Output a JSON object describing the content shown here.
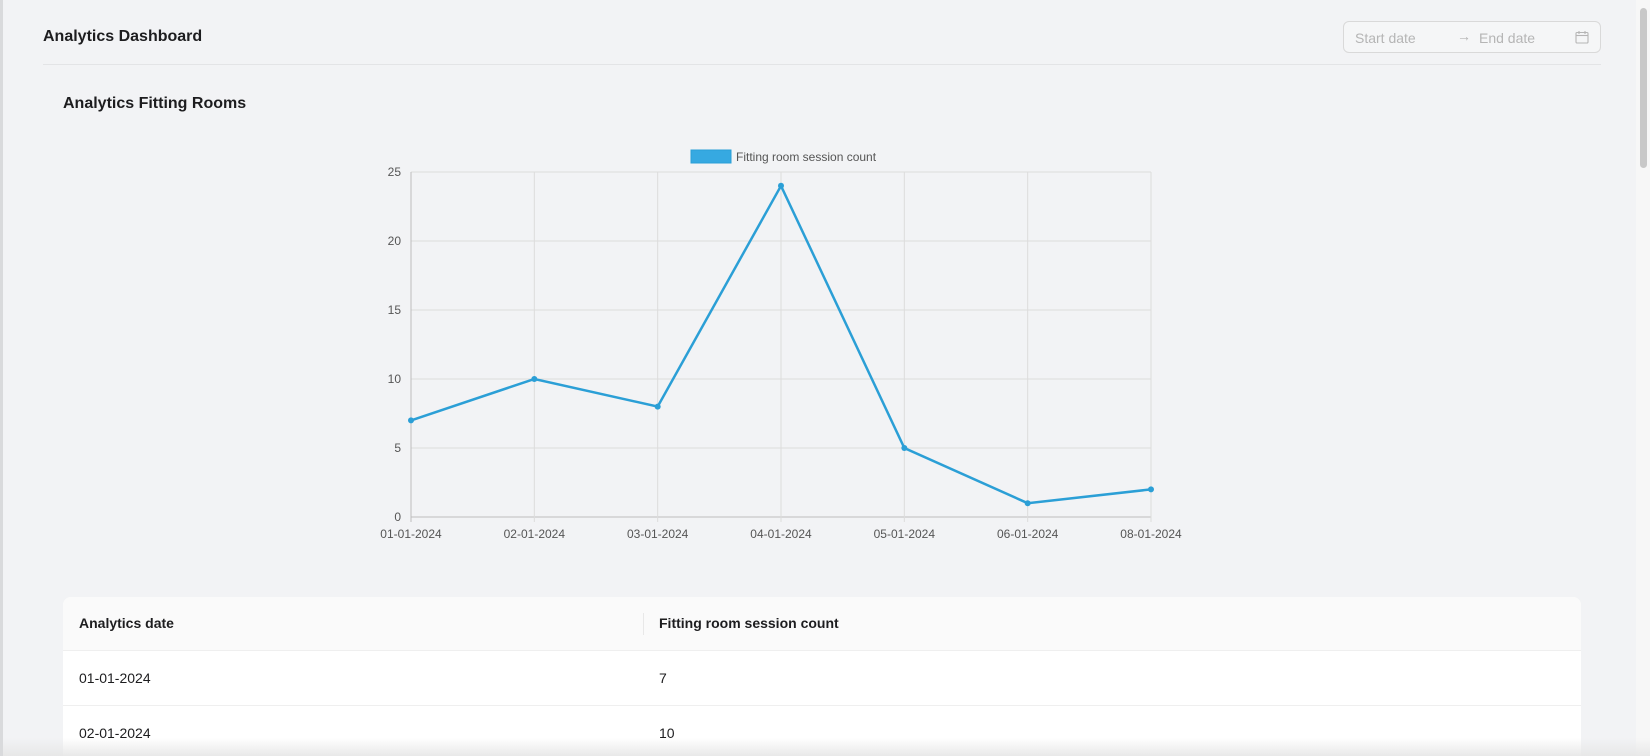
{
  "header": {
    "title": "Analytics Dashboard",
    "date_range": {
      "start_placeholder": "Start date",
      "arrow": "→",
      "end_placeholder": "End date",
      "icon": "calendar-icon"
    }
  },
  "section": {
    "title": "Analytics Fitting Rooms"
  },
  "chart_data": {
    "type": "line",
    "categories": [
      "01-01-2024",
      "02-01-2024",
      "03-01-2024",
      "04-01-2024",
      "05-01-2024",
      "06-01-2024",
      "08-01-2024"
    ],
    "series": [
      {
        "name": "Fitting room session count",
        "values": [
          7,
          10,
          8,
          24,
          5,
          1,
          2
        ]
      }
    ],
    "ylim": [
      0,
      25
    ],
    "yticks": [
      0,
      5,
      10,
      15,
      20,
      25
    ],
    "grid": true,
    "legend": "top-center",
    "colors": {
      "line": "#2b9fd6",
      "legend_fill": "#36a9e1"
    }
  },
  "table": {
    "columns": [
      "Analytics date",
      "Fitting room session count"
    ],
    "rows": [
      {
        "date": "01-01-2024",
        "count": "7"
      },
      {
        "date": "02-01-2024",
        "count": "10"
      }
    ]
  }
}
